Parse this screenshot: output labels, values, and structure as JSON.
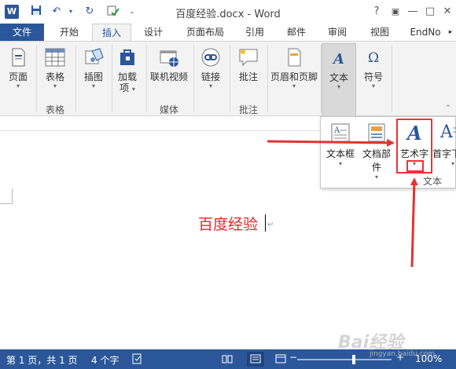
{
  "window": {
    "title": "百度经验.docx - Word",
    "logo": "W",
    "help": "?",
    "minimize": "—",
    "maximize": "□",
    "close": "✕"
  },
  "tabs": [
    "文件",
    "开始",
    "插入",
    "设计",
    "页面布局",
    "引用",
    "邮件",
    "审阅",
    "视图",
    "EndNo"
  ],
  "ribbon": {
    "page": "页面",
    "table": "表格",
    "table_group": "表格",
    "illustration": "插图",
    "addin_line1": "加载",
    "addin_line2": "项",
    "online_video": "联机视频",
    "media_group": "媒体",
    "link": "链接",
    "comment": "批注",
    "comment_group": "批注",
    "header_footer": "页眉和页脚",
    "text": "文本",
    "symbol": "符号"
  },
  "panel": {
    "textbox": "文本框",
    "quickparts": "文档部件",
    "wordart": "艺术字",
    "dropcap": "首字下",
    "group_label": "文本"
  },
  "document": {
    "text": "百度经验"
  },
  "status": {
    "page": "第 1 页，共 1 页",
    "words": "4 个字",
    "zoom": "100%"
  },
  "watermark": "Bai经验",
  "watermark_sub": "jingyan.baidu.com",
  "colors": {
    "accent": "#2b579a",
    "highlight": "#e33333",
    "doc_text": "#e8262c"
  }
}
